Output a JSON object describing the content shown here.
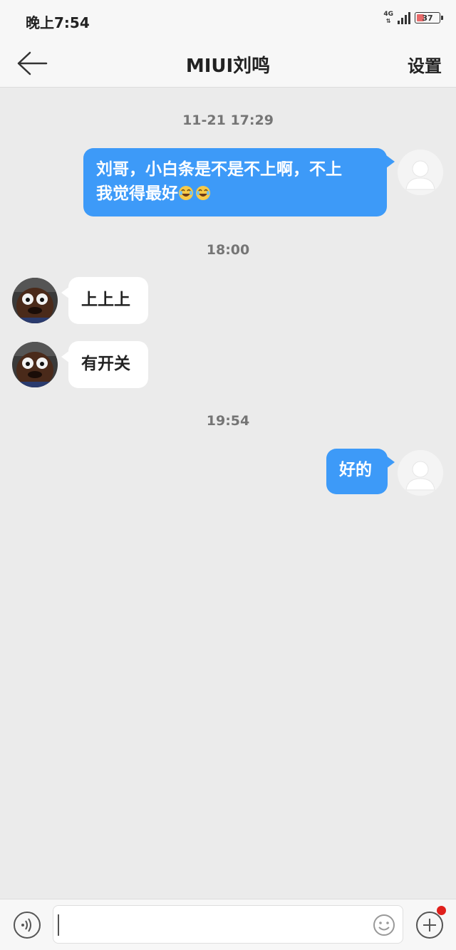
{
  "status_bar": {
    "time": "晚上7:54",
    "network": "4G",
    "battery": "37"
  },
  "header": {
    "title": "MIUI刘鸣",
    "settings_label": "设置"
  },
  "messages": [
    {
      "timestamp": "11-21 17:29"
    },
    {
      "direction": "out",
      "line1": "刘哥，小白条是不是不上啊，不上",
      "line2": "我觉得最好"
    },
    {
      "timestamp": "18:00"
    },
    {
      "direction": "in",
      "text": "上上上"
    },
    {
      "direction": "in",
      "text": "有开关"
    },
    {
      "timestamp": "19:54"
    },
    {
      "direction": "out",
      "text": "好的"
    }
  ],
  "input_bar": {
    "placeholder": ""
  },
  "colors": {
    "outgoing_bubble": "#3d9af8",
    "incoming_bubble": "#ffffff",
    "background": "#ebebeb",
    "notification_dot": "#e0201c"
  }
}
